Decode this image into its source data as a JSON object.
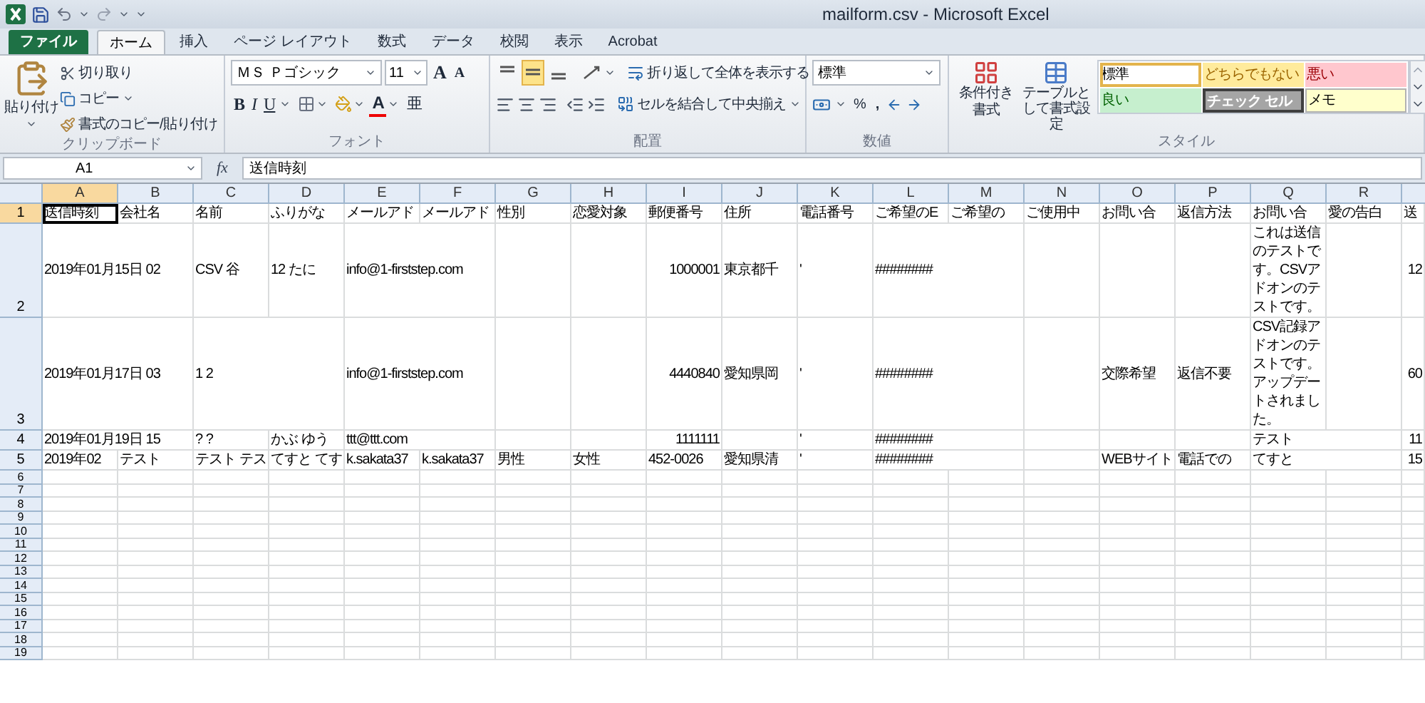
{
  "window": {
    "title": "mailform.csv - Microsoft Excel"
  },
  "ribbon_tabs": [
    {
      "label": "ファイル",
      "kind": "file",
      "selected": false
    },
    {
      "label": "ホーム",
      "kind": "tab",
      "selected": true
    },
    {
      "label": "挿入",
      "kind": "tab",
      "selected": false
    },
    {
      "label": "ページ レイアウト",
      "kind": "tab",
      "selected": false
    },
    {
      "label": "数式",
      "kind": "tab",
      "selected": false
    },
    {
      "label": "データ",
      "kind": "tab",
      "selected": false
    },
    {
      "label": "校閲",
      "kind": "tab",
      "selected": false
    },
    {
      "label": "表示",
      "kind": "tab",
      "selected": false
    },
    {
      "label": "Acrobat",
      "kind": "tab",
      "selected": false
    }
  ],
  "clipboard": {
    "label": "クリップボード",
    "paste": "貼り付け",
    "cut": "切り取り",
    "copy": "コピー",
    "format_painter": "書式のコピー/貼り付け"
  },
  "font": {
    "label": "フォント",
    "font_name": "ＭＳ Ｐゴシック",
    "font_size": "11",
    "grow": "A",
    "shrink": "A",
    "bold": "B",
    "italic": "I",
    "underline": "U",
    "font_color": "A",
    "phonetic": "亜"
  },
  "alignment": {
    "label": "配置",
    "vertical_align_buttons": [
      {
        "selected": false
      },
      {
        "selected": true
      },
      {
        "selected": false
      }
    ],
    "wrap_text": "折り返して全体を表示する",
    "merge_center": "セルを結合して中央揃え"
  },
  "number": {
    "label": "数値",
    "format": "標準",
    "percent": "%",
    "comma": ","
  },
  "styles": {
    "label": "スタイル",
    "conditional_formatting": "条件付き書式",
    "format_as_table": "テーブルとして書式設定",
    "gallery": [
      {
        "label": "標準",
        "kind": "normal",
        "selected": true
      },
      {
        "label": "どちらでもない",
        "kind": "neutral",
        "selected": false
      },
      {
        "label": "悪い",
        "kind": "bad",
        "selected": false
      },
      {
        "label": "良い",
        "kind": "good",
        "selected": false
      },
      {
        "label": "チェック セル",
        "kind": "check",
        "selected": false
      },
      {
        "label": "メモ",
        "kind": "note",
        "selected": false
      }
    ]
  },
  "formula_bar": {
    "name_box": "A1",
    "function_label": "fx",
    "content": "送信時刻"
  },
  "sheet": {
    "columns": [
      {
        "label": "A",
        "selected": true
      },
      {
        "label": "B",
        "selected": false
      },
      {
        "label": "C",
        "selected": false
      },
      {
        "label": "D",
        "selected": false
      },
      {
        "label": "E",
        "selected": false
      },
      {
        "label": "F",
        "selected": false
      },
      {
        "label": "G",
        "selected": false
      },
      {
        "label": "H",
        "selected": false
      },
      {
        "label": "I",
        "selected": false
      },
      {
        "label": "J",
        "selected": false
      },
      {
        "label": "K",
        "selected": false
      },
      {
        "label": "L",
        "selected": false
      },
      {
        "label": "M",
        "selected": false
      },
      {
        "label": "N",
        "selected": false
      },
      {
        "label": "O",
        "selected": false
      },
      {
        "label": "P",
        "selected": false
      },
      {
        "label": "Q",
        "selected": false
      },
      {
        "label": "R",
        "selected": false
      }
    ],
    "rows": [
      {
        "number": "1",
        "selected": true,
        "cells": [
          {
            "kind": "text",
            "text": "送信時刻",
            "active": true
          },
          {
            "kind": "text",
            "text": "会社名"
          },
          {
            "kind": "text",
            "text": "名前"
          },
          {
            "kind": "text",
            "text": "ふりがな"
          },
          {
            "kind": "text",
            "text": "メールアド"
          },
          {
            "kind": "text",
            "text": "メールアド"
          },
          {
            "kind": "text",
            "text": "性別"
          },
          {
            "kind": "text",
            "text": "恋愛対象"
          },
          {
            "kind": "text",
            "text": "郵便番号"
          },
          {
            "kind": "text",
            "text": "住所"
          },
          {
            "kind": "text",
            "text": "電話番号"
          },
          {
            "kind": "text",
            "text": "ご希望のE"
          },
          {
            "kind": "text",
            "text": "ご希望の"
          },
          {
            "kind": "text",
            "text": "ご使用中"
          },
          {
            "kind": "text",
            "text": "お問い合"
          },
          {
            "kind": "text",
            "text": "返信方法"
          },
          {
            "kind": "text",
            "text": "お問い合"
          },
          {
            "kind": "text",
            "text": "愛の告白"
          },
          {
            "kind": "text",
            "text": "送"
          }
        ]
      },
      {
        "number": "2",
        "selected": false,
        "cells": [
          {
            "kind": "text",
            "text": "2019年01月15日 02"
          },
          {
            "kind": "empty"
          },
          {
            "kind": "text",
            "text": "CSV 谷"
          },
          {
            "kind": "text",
            "text": "12 たに"
          },
          {
            "kind": "text",
            "text": "info@1-firststep.com"
          },
          {
            "kind": "empty"
          },
          {
            "kind": "empty"
          },
          {
            "kind": "empty"
          },
          {
            "kind": "number",
            "text": "1000001"
          },
          {
            "kind": "text",
            "text": "東京都千"
          },
          {
            "kind": "text",
            "text": "'"
          },
          {
            "kind": "text",
            "text": "########"
          },
          {
            "kind": "empty"
          },
          {
            "kind": "empty"
          },
          {
            "kind": "empty"
          },
          {
            "kind": "empty"
          },
          {
            "kind": "wrap",
            "text": "これは送信のテストです。CSVアドオンのテストです。"
          },
          {
            "kind": "empty"
          },
          {
            "kind": "number",
            "text": "12"
          }
        ]
      },
      {
        "number": "3",
        "selected": false,
        "cells": [
          {
            "kind": "text",
            "text": "2019年01月17日 03"
          },
          {
            "kind": "empty"
          },
          {
            "kind": "text",
            "text": "1 2"
          },
          {
            "kind": "empty"
          },
          {
            "kind": "text",
            "text": "info@1-firststep.com"
          },
          {
            "kind": "empty"
          },
          {
            "kind": "empty"
          },
          {
            "kind": "empty"
          },
          {
            "kind": "number",
            "text": "4440840"
          },
          {
            "kind": "text",
            "text": "愛知県岡"
          },
          {
            "kind": "text",
            "text": "'"
          },
          {
            "kind": "text",
            "text": "########"
          },
          {
            "kind": "empty"
          },
          {
            "kind": "empty"
          },
          {
            "kind": "text",
            "text": "交際希望"
          },
          {
            "kind": "text",
            "text": "返信不要"
          },
          {
            "kind": "wrap",
            "text": "CSV記録アドオンのテストです。アップデートされました。"
          },
          {
            "kind": "empty"
          },
          {
            "kind": "number",
            "text": "60"
          }
        ]
      },
      {
        "number": "4",
        "selected": false,
        "cells": [
          {
            "kind": "text",
            "text": "2019年01月19日 15"
          },
          {
            "kind": "empty"
          },
          {
            "kind": "text",
            "text": "? ?"
          },
          {
            "kind": "text",
            "text": "かぶ ゆう"
          },
          {
            "kind": "text",
            "text": "ttt@ttt.com"
          },
          {
            "kind": "empty"
          },
          {
            "kind": "empty"
          },
          {
            "kind": "empty"
          },
          {
            "kind": "number",
            "text": "1111111"
          },
          {
            "kind": "empty"
          },
          {
            "kind": "text",
            "text": "'"
          },
          {
            "kind": "text",
            "text": "########"
          },
          {
            "kind": "empty"
          },
          {
            "kind": "empty"
          },
          {
            "kind": "empty"
          },
          {
            "kind": "empty"
          },
          {
            "kind": "text",
            "text": "テスト"
          },
          {
            "kind": "empty"
          },
          {
            "kind": "number",
            "text": "11"
          }
        ]
      },
      {
        "number": "5",
        "selected": false,
        "cells": [
          {
            "kind": "text",
            "text": "2019年02"
          },
          {
            "kind": "text",
            "text": "テスト"
          },
          {
            "kind": "text",
            "text": "テスト テス"
          },
          {
            "kind": "text",
            "text": "てすと てす"
          },
          {
            "kind": "text",
            "text": "k.sakata37"
          },
          {
            "kind": "text",
            "text": "k.sakata37"
          },
          {
            "kind": "text",
            "text": "男性"
          },
          {
            "kind": "text",
            "text": "女性"
          },
          {
            "kind": "text",
            "text": "452-0026"
          },
          {
            "kind": "text",
            "text": "愛知県清"
          },
          {
            "kind": "text",
            "text": "'"
          },
          {
            "kind": "text",
            "text": "########"
          },
          {
            "kind": "empty"
          },
          {
            "kind": "empty"
          },
          {
            "kind": "text",
            "text": "WEBサイト"
          },
          {
            "kind": "text",
            "text": "電話での"
          },
          {
            "kind": "text",
            "text": "てすと"
          },
          {
            "kind": "empty"
          },
          {
            "kind": "number",
            "text": "15"
          }
        ]
      },
      {
        "number": "6",
        "selected": false
      },
      {
        "number": "7",
        "selected": false
      },
      {
        "number": "8",
        "selected": false
      },
      {
        "number": "9",
        "selected": false
      },
      {
        "number": "10",
        "selected": false
      },
      {
        "number": "11",
        "selected": false
      },
      {
        "number": "12",
        "selected": false
      },
      {
        "number": "13",
        "selected": false
      },
      {
        "number": "14",
        "selected": false
      },
      {
        "number": "15",
        "selected": false
      },
      {
        "number": "16",
        "selected": false
      },
      {
        "number": "17",
        "selected": false
      },
      {
        "number": "18",
        "selected": false
      },
      {
        "number": "19",
        "selected": false
      }
    ]
  }
}
